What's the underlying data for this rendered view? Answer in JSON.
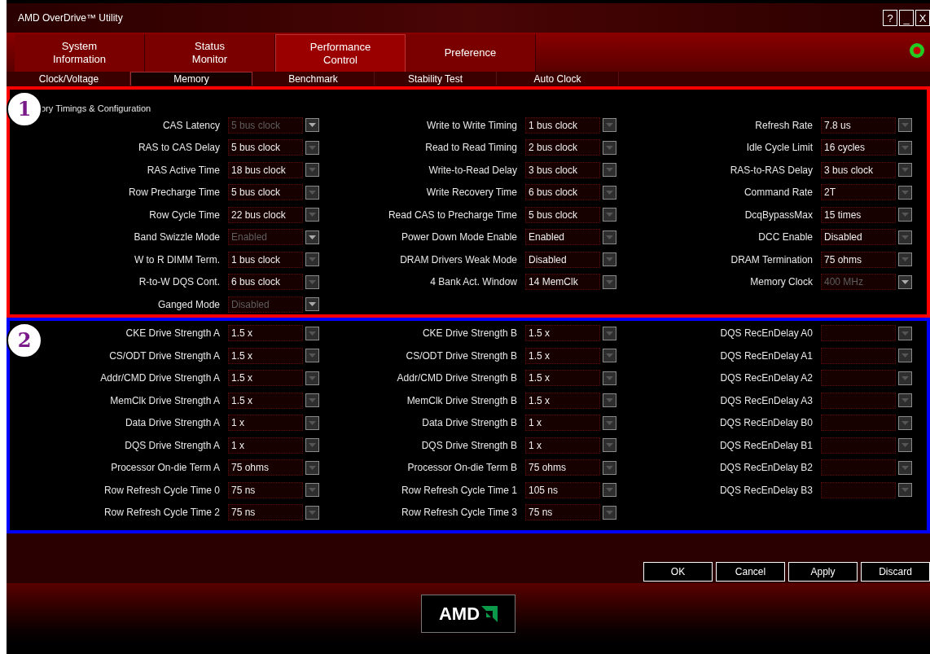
{
  "window": {
    "title": "AMD OverDrive™ Utility",
    "controls": [
      "?",
      "_",
      "X"
    ]
  },
  "main_tabs": [
    {
      "label": "System\nInformation",
      "selected": false
    },
    {
      "label": "Status\nMonitor",
      "selected": false
    },
    {
      "label": "Performance\nControl",
      "selected": true
    },
    {
      "label": "Preference",
      "selected": false
    }
  ],
  "sub_tabs": [
    {
      "label": "Clock/Voltage",
      "selected": false
    },
    {
      "label": "Memory",
      "selected": true
    },
    {
      "label": "Benchmark",
      "selected": false
    },
    {
      "label": "Stability Test",
      "selected": false
    },
    {
      "label": "Auto Clock",
      "selected": false
    }
  ],
  "sections": [
    {
      "callout": "1",
      "color": "#ff0000",
      "title": "ory Timings & Configuration",
      "columns": [
        [
          {
            "label": "CAS Latency",
            "value": "5 bus clock",
            "disabled": true
          },
          {
            "label": "RAS to CAS Delay",
            "value": "5 bus clock",
            "disabled": false
          },
          {
            "label": "RAS Active Time",
            "value": "18 bus clock",
            "disabled": false
          },
          {
            "label": "Row Precharge Time",
            "value": "5 bus clock",
            "disabled": false
          },
          {
            "label": "Row Cycle Time",
            "value": "22 bus clock",
            "disabled": false
          },
          {
            "label": "Band Swizzle Mode",
            "value": "Enabled",
            "disabled": true
          },
          {
            "label": "W to R DIMM Term.",
            "value": "1 bus clock",
            "disabled": false
          },
          {
            "label": "R-to-W DQS Cont.",
            "value": "6 bus clock",
            "disabled": false
          },
          {
            "label": "Ganged Mode",
            "value": "Disabled",
            "disabled": true
          }
        ],
        [
          {
            "label": "Write to Write Timing",
            "value": "1 bus clock",
            "disabled": false
          },
          {
            "label": "Read to Read Timing",
            "value": "2 bus clock",
            "disabled": false
          },
          {
            "label": "Write-to-Read Delay",
            "value": "3 bus clock",
            "disabled": false
          },
          {
            "label": "Write Recovery Time",
            "value": "6 bus clock",
            "disabled": false
          },
          {
            "label": "Read CAS to Precharge Time",
            "value": "5 bus clock",
            "disabled": false
          },
          {
            "label": "Power Down Mode Enable",
            "value": "Enabled",
            "disabled": false
          },
          {
            "label": "DRAM Drivers Weak Mode",
            "value": "Disabled",
            "disabled": false
          },
          {
            "label": "4 Bank Act. Window",
            "value": "14 MemClk",
            "disabled": false
          }
        ],
        [
          {
            "label": "Refresh Rate",
            "value": "7.8 us",
            "disabled": false
          },
          {
            "label": "Idle Cycle Limit",
            "value": "16 cycles",
            "disabled": false
          },
          {
            "label": "RAS-to-RAS Delay",
            "value": "3 bus clock",
            "disabled": false
          },
          {
            "label": "Command Rate",
            "value": "2T",
            "disabled": false
          },
          {
            "label": "DcqBypassMax",
            "value": "15 times",
            "disabled": false
          },
          {
            "label": "DCC Enable",
            "value": "Disabled",
            "disabled": false
          },
          {
            "label": "DRAM Termination",
            "value": "75 ohms",
            "disabled": false
          },
          {
            "label": "Memory Clock",
            "value": "400 MHz",
            "disabled": true
          }
        ]
      ]
    },
    {
      "callout": "2",
      "color": "#0000ff",
      "columns": [
        [
          {
            "label": "CKE Drive Strength A",
            "value": "1.5 x",
            "disabled": false
          },
          {
            "label": "CS/ODT Drive Strength A",
            "value": "1.5 x",
            "disabled": false
          },
          {
            "label": "Addr/CMD Drive Strength A",
            "value": "1.5 x",
            "disabled": false
          },
          {
            "label": "MemClk Drive Strength A",
            "value": "1.5 x",
            "disabled": false
          },
          {
            "label": "Data Drive Strength A",
            "value": "1 x",
            "disabled": false
          },
          {
            "label": "DQS Drive Strength A",
            "value": "1 x",
            "disabled": false
          },
          {
            "label": "Processor On-die Term A",
            "value": "75 ohms",
            "disabled": false
          },
          {
            "label": "Row Refresh Cycle Time 0",
            "value": "75 ns",
            "disabled": false
          },
          {
            "label": "Row Refresh Cycle Time 2",
            "value": "75 ns",
            "disabled": false
          }
        ],
        [
          {
            "label": "CKE Drive Strength B",
            "value": "1.5 x",
            "disabled": false
          },
          {
            "label": "CS/ODT Drive Strength B",
            "value": "1.5 x",
            "disabled": false
          },
          {
            "label": "Addr/CMD Drive Strength B",
            "value": "1.5 x",
            "disabled": false
          },
          {
            "label": "MemClk Drive Strength B",
            "value": "1.5 x",
            "disabled": false
          },
          {
            "label": "Data Drive Strength B",
            "value": "1 x",
            "disabled": false
          },
          {
            "label": "DQS Drive Strength B",
            "value": "1 x",
            "disabled": false
          },
          {
            "label": "Processor On-die Term B",
            "value": "75 ohms",
            "disabled": false
          },
          {
            "label": "Row Refresh Cycle Time 1",
            "value": "105 ns",
            "disabled": false
          },
          {
            "label": "Row Refresh Cycle Time 3",
            "value": "75 ns",
            "disabled": false
          }
        ],
        [
          {
            "label": "DQS RecEnDelay A0"
          },
          {
            "label": "DQS RecEnDelay A1"
          },
          {
            "label": "DQS RecEnDelay A2"
          },
          {
            "label": "DQS RecEnDelay A3"
          },
          {
            "label": "DQS RecEnDelay B0"
          },
          {
            "label": "DQS RecEnDelay B1"
          },
          {
            "label": "DQS RecEnDelay B2"
          },
          {
            "label": "DQS RecEnDelay B3"
          }
        ]
      ]
    }
  ],
  "buttons": [
    "OK",
    "Cancel",
    "Apply",
    "Discard"
  ],
  "logo": "AMD"
}
